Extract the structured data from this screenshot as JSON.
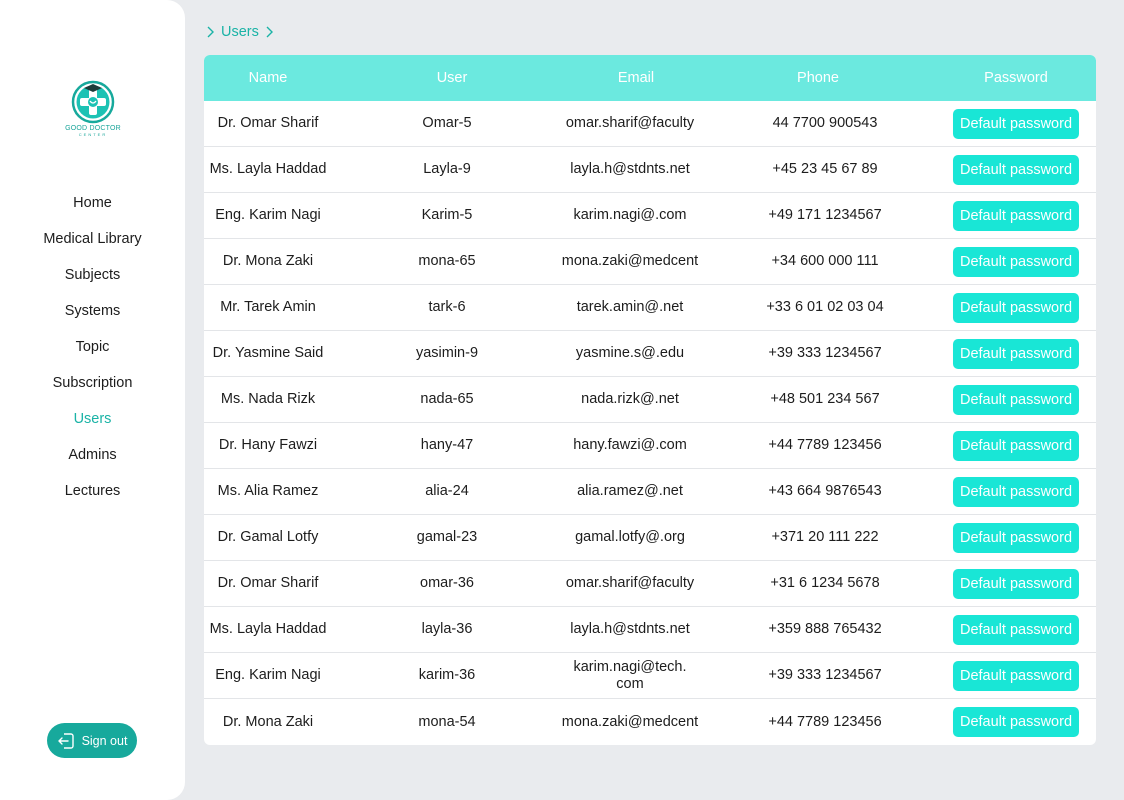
{
  "logo": {
    "title": "GOOD DOCTOR",
    "subtitle": "CENTER"
  },
  "nav": {
    "items": [
      {
        "label": "Home",
        "active": false
      },
      {
        "label": "Medical Library",
        "active": false
      },
      {
        "label": "Subjects",
        "active": false
      },
      {
        "label": "Systems",
        "active": false
      },
      {
        "label": "Topic",
        "active": false
      },
      {
        "label": "Subscription",
        "active": false
      },
      {
        "label": "Users",
        "active": true
      },
      {
        "label": "Admins",
        "active": false
      },
      {
        "label": "Lectures",
        "active": false
      }
    ]
  },
  "signout": {
    "label": "Sign out",
    "icon": "sign-out-icon"
  },
  "breadcrumb": {
    "label": "Users"
  },
  "colors": {
    "accent": "#1ab3a6",
    "header": "#6be9df",
    "button": "#19e6d6",
    "signout": "#17a99c"
  },
  "table": {
    "headers": [
      "Name",
      "User",
      "Email",
      "Phone",
      "Password"
    ],
    "button_label": "Default password",
    "rows": [
      {
        "name": "Dr. Omar Sharif",
        "user": "Omar-5",
        "email": "omar.sharif@faculty",
        "phone": "44 7700 900543"
      },
      {
        "name": "Ms. Layla Haddad",
        "user": "Layla-9",
        "email": "layla.h@stdnts.net",
        "phone": "+45 23 45 67 89"
      },
      {
        "name": "Eng. Karim Nagi",
        "user": "Karim-5",
        "email": "karim.nagi@.com",
        "phone": "+49 171 1234567"
      },
      {
        "name": "Dr. Mona Zaki",
        "user": "mona-65",
        "email": "mona.zaki@medcent",
        "phone": "+34 600 000 111"
      },
      {
        "name": "Mr. Tarek Amin",
        "user": "tark-6",
        "email": "tarek.amin@.net",
        "phone": "+33 6 01 02 03 04"
      },
      {
        "name": "Dr. Yasmine Said",
        "user": "yasimin-9",
        "email": "yasmine.s@.edu",
        "phone": "+39 333 1234567"
      },
      {
        "name": "Ms. Nada Rizk",
        "user": "nada-65",
        "email": "nada.rizk@.net",
        "phone": "+48 501 234 567"
      },
      {
        "name": "Dr. Hany Fawzi",
        "user": "hany-47",
        "email": "hany.fawzi@.com",
        "phone": "+44 7789 123456"
      },
      {
        "name": "Ms. Alia Ramez",
        "user": "alia-24",
        "email": "alia.ramez@.net",
        "phone": "+43 664 9876543"
      },
      {
        "name": "Dr. Gamal Lotfy",
        "user": "gamal-23",
        "email": "gamal.lotfy@.org",
        "phone": "+371 20 111 222"
      },
      {
        "name": "Dr. Omar Sharif",
        "user": "omar-36",
        "email": "omar.sharif@faculty",
        "phone": "+31 6 1234 5678"
      },
      {
        "name": "Ms. Layla Haddad",
        "user": "layla-36",
        "email": "layla.h@stdnts.net",
        "phone": "+359 888 765432"
      },
      {
        "name": "Eng. Karim Nagi",
        "user": "karim-36",
        "email": "karim.nagi@tech.\ncom",
        "phone": "+39 333 1234567"
      },
      {
        "name": "Dr. Mona Zaki",
        "user": "mona-54",
        "email": "mona.zaki@medcent",
        "phone": "+44 7789 123456"
      }
    ]
  }
}
